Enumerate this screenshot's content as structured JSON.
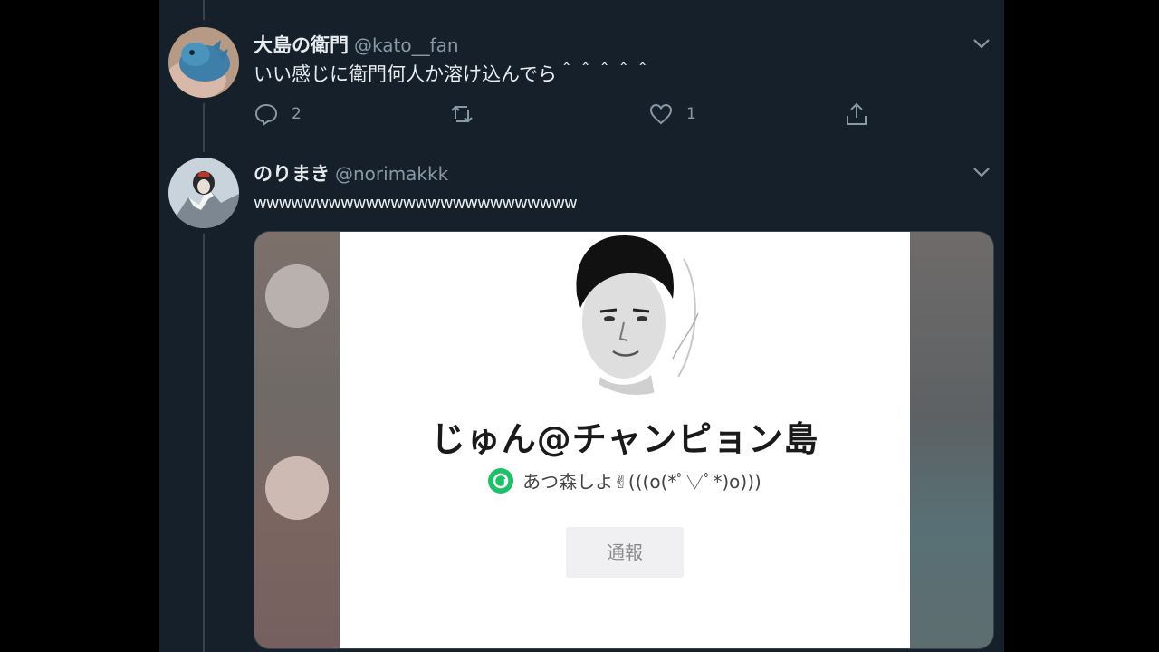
{
  "tweets": [
    {
      "name": "大島の衛門",
      "handle": "@kato__fan",
      "text": "いい感じに衛門何人か溶け込んでら＾＾＾＾＾",
      "replies": "2",
      "retweets": "",
      "likes": "1"
    },
    {
      "name": "のりまき",
      "handle": "@norimakkk",
      "text": "wwwwwwwwwwwwwwwwwwwwwwwwww"
    }
  ],
  "media_card": {
    "profile_name": "じゅん@チャンピョン島",
    "status_text": "あつ森しよ✌(((o(*ﾟ▽ﾟ*)o)))",
    "report_label": "通報"
  },
  "colors": {
    "background": "#15202b",
    "divider": "#38444d",
    "secondary_text": "#8899a6",
    "badge_green": "#1ec168"
  }
}
